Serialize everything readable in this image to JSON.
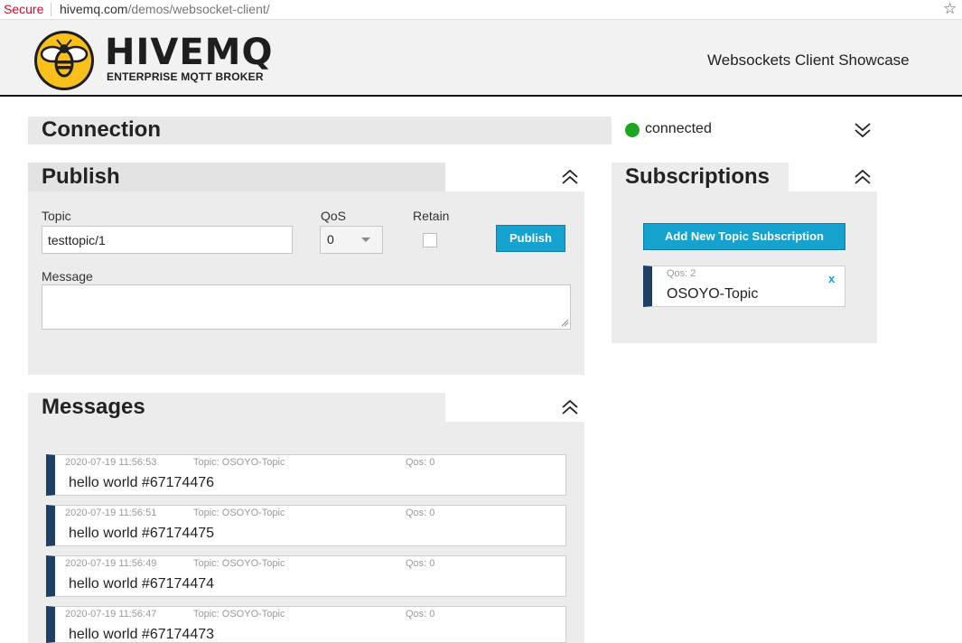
{
  "browser": {
    "secure_label": "Secure",
    "url_host": "hivemq.com",
    "url_path": "/demos/websocket-client/",
    "bookmark_icon": "star-icon"
  },
  "header": {
    "logo_name": "HIVEMQ",
    "logo_tagline": "ENTERPRISE MQTT BROKER",
    "showcase_label": "Websockets Client Showcase",
    "brand_yellow": "#f9c01c",
    "brand_dark": "#1e1e1e"
  },
  "connection": {
    "title": "Connection",
    "status": "connected",
    "status_color": "#1fa51f",
    "toggle_icon": "double-chevron-down-icon"
  },
  "publish": {
    "title": "Publish",
    "toggle_icon": "double-chevron-up-icon",
    "topic_label": "Topic",
    "topic_value": "testtopic/1",
    "qos_label": "QoS",
    "qos_value": "0",
    "retain_label": "Retain",
    "retain_checked": false,
    "publish_button": "Publish",
    "message_label": "Message",
    "message_value": ""
  },
  "subscriptions": {
    "title": "Subscriptions",
    "toggle_icon": "double-chevron-up-icon",
    "add_button": "Add New Topic Subscription",
    "items": [
      {
        "qos_text": "Qos: 2",
        "topic": "OSOYO-Topic",
        "close_label": "x",
        "color": "#1f3f66"
      }
    ]
  },
  "messages": {
    "title": "Messages",
    "toggle_icon": "double-chevron-up-icon",
    "items": [
      {
        "time": "2020-07-19 11:56:53",
        "topic": "Topic: OSOYO-Topic",
        "qos": "Qos: 0",
        "body": "hello world #67174476"
      },
      {
        "time": "2020-07-19 11:56:51",
        "topic": "Topic: OSOYO-Topic",
        "qos": "Qos: 0",
        "body": "hello world #67174475"
      },
      {
        "time": "2020-07-19 11:56:49",
        "topic": "Topic: OSOYO-Topic",
        "qos": "Qos: 0",
        "body": "hello world #67174474"
      },
      {
        "time": "2020-07-19 11:56:47",
        "topic": "Topic: OSOYO-Topic",
        "qos": "Qos: 0",
        "body": "hello world #67174473"
      }
    ]
  },
  "colors": {
    "accent": "#16a2cf",
    "item_stripe": "#1f3f66"
  }
}
